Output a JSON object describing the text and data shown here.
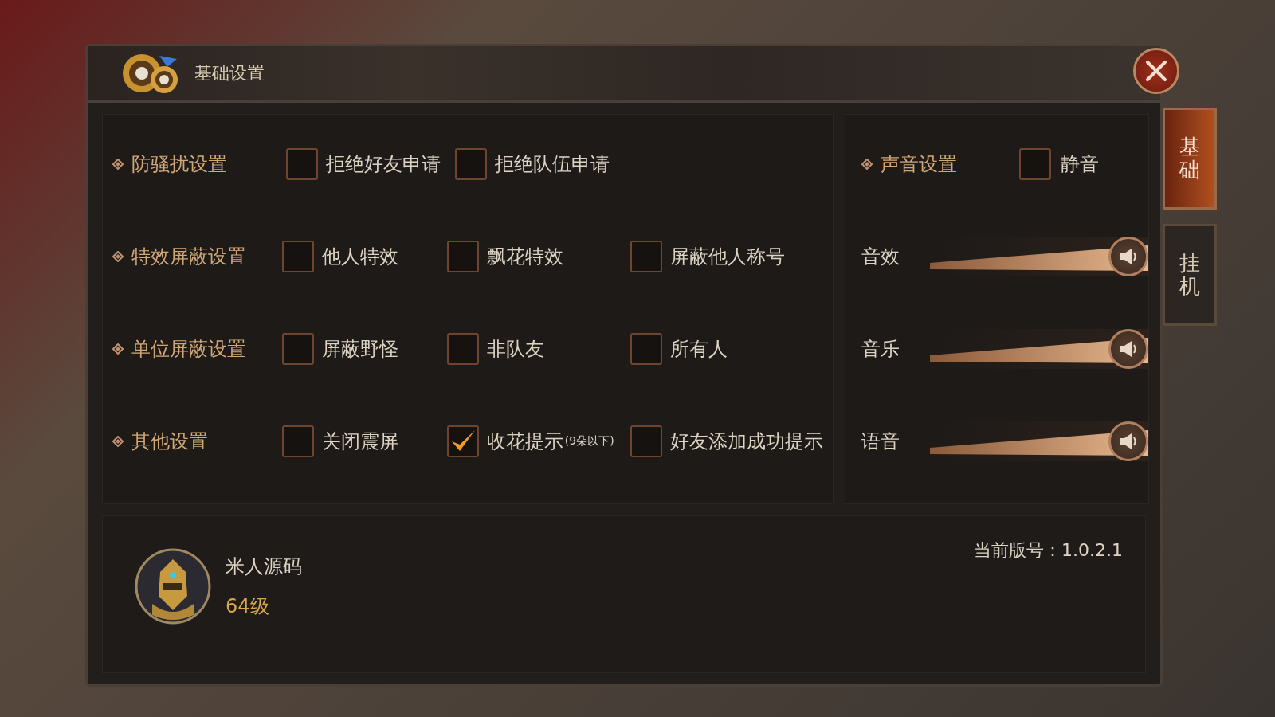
{
  "window": {
    "title": "基础设置"
  },
  "side_tabs": [
    {
      "label": "基础",
      "selected": true
    },
    {
      "label": "挂机",
      "selected": false
    }
  ],
  "settings": [
    {
      "label": "防骚扰设置",
      "options": [
        {
          "label": "拒绝好友申请",
          "checked": false
        },
        {
          "label": "拒绝队伍申请",
          "checked": false
        }
      ]
    },
    {
      "label": "特效屏蔽设置",
      "options": [
        {
          "label": "他人特效",
          "checked": false
        },
        {
          "label": "飘花特效",
          "checked": false
        },
        {
          "label": "屏蔽他人称号",
          "checked": false
        }
      ]
    },
    {
      "label": "单位屏蔽设置",
      "options": [
        {
          "label": "屏蔽野怪",
          "checked": false
        },
        {
          "label": "非队友",
          "checked": false
        },
        {
          "label": "所有人",
          "checked": false
        }
      ]
    },
    {
      "label": "其他设置",
      "options": [
        {
          "label": "关闭震屏",
          "checked": false
        },
        {
          "label": "收花提示",
          "note": "(9朵以下)",
          "checked": true
        },
        {
          "label": "好友添加成功提示",
          "checked": false
        }
      ]
    }
  ],
  "sound": {
    "label": "声音设置",
    "mute": {
      "label": "静音",
      "checked": false
    },
    "sliders": [
      {
        "label": "音效",
        "level": 1
      },
      {
        "label": "音乐",
        "level": 1
      },
      {
        "label": "语音",
        "level": 1
      }
    ]
  },
  "player": {
    "name": "米人源码",
    "level_text": "64级"
  },
  "version": "当前版号：1.0.2.1"
}
